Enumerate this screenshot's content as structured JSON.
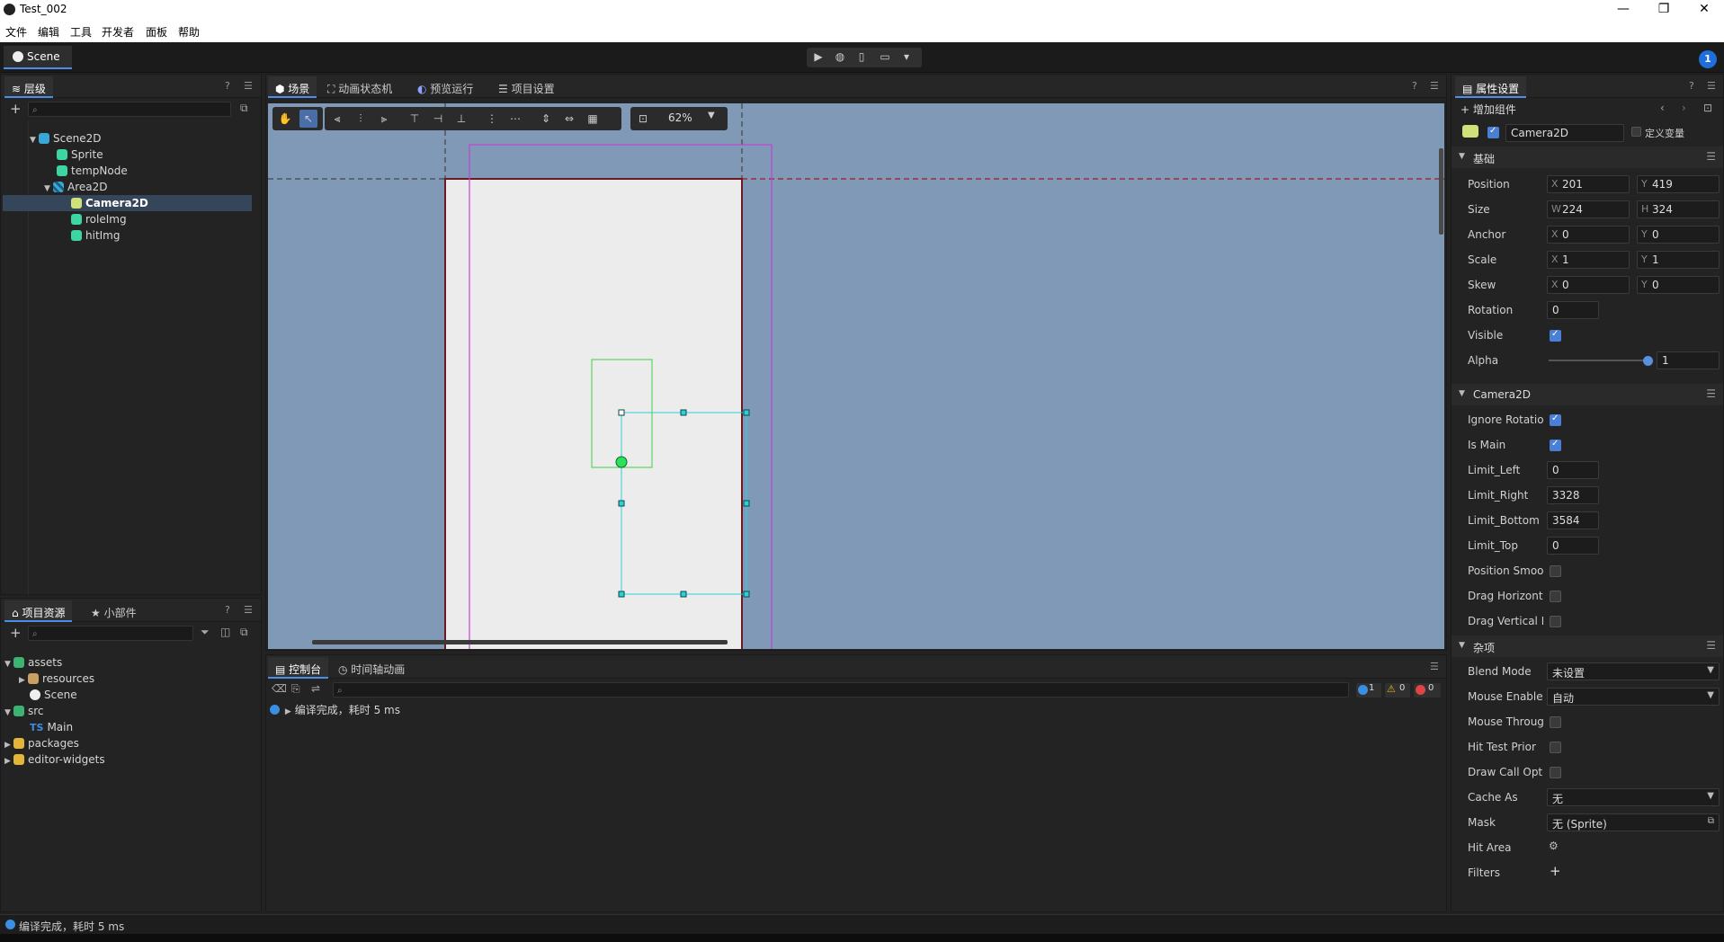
{
  "window": {
    "title": "Test_002",
    "minimize": "—",
    "restore": "❐",
    "close": "✕"
  },
  "menu": [
    "文件",
    "编辑",
    "工具",
    "开发者",
    "面板",
    "帮助"
  ],
  "top": {
    "scene_tab": "Scene",
    "notification_count": "1"
  },
  "hierarchy": {
    "tab": "层级",
    "items": [
      {
        "label": "Scene2D"
      },
      {
        "label": "Sprite"
      },
      {
        "label": "tempNode"
      },
      {
        "label": "Area2D"
      },
      {
        "label": "Camera2D"
      },
      {
        "label": "roleImg"
      },
      {
        "label": "hitImg"
      }
    ]
  },
  "assets": {
    "tabs": [
      "项目资源",
      "小部件"
    ],
    "items": [
      {
        "label": "assets"
      },
      {
        "label": "resources"
      },
      {
        "label": "Scene"
      },
      {
        "label": "src"
      },
      {
        "label": "Main",
        "prefix": "TS"
      },
      {
        "label": "packages"
      },
      {
        "label": "editor-widgets"
      }
    ]
  },
  "center": {
    "tabs": [
      "场景",
      "动画状态机",
      "预览运行",
      "项目设置"
    ],
    "zoom": "62%"
  },
  "console": {
    "tabs": [
      "控制台",
      "时间轴动画"
    ],
    "info_count": "1",
    "warn_count": "0",
    "error_count": "0",
    "message": "编译完成，耗时 5 ms"
  },
  "inspector": {
    "tab": "属性设置",
    "add_component": "增加组件",
    "node_name": "Camera2D",
    "define_var": "定义变量",
    "sections": {
      "base": "基础",
      "camera": "Camera2D",
      "misc": "杂项"
    },
    "position": {
      "label": "Position",
      "x": "201",
      "y": "419"
    },
    "size": {
      "label": "Size",
      "w": "224",
      "h": "324"
    },
    "anchor": {
      "label": "Anchor",
      "x": "0",
      "y": "0"
    },
    "scale": {
      "label": "Scale",
      "x": "1",
      "y": "1"
    },
    "skew": {
      "label": "Skew",
      "x": "0",
      "y": "0"
    },
    "rotation": {
      "label": "Rotation",
      "value": "0"
    },
    "visible": {
      "label": "Visible"
    },
    "alpha": {
      "label": "Alpha",
      "value": "1"
    },
    "ignore_rotation": {
      "label": "Ignore Rotation"
    },
    "is_main": {
      "label": "Is Main"
    },
    "limit_left": {
      "label": "Limit_Left",
      "value": "0"
    },
    "limit_right": {
      "label": "Limit_Right",
      "value": "3328"
    },
    "limit_bottom": {
      "label": "Limit_Bottom",
      "value": "3584"
    },
    "limit_top": {
      "label": "Limit_Top",
      "value": "0"
    },
    "position_smooth": {
      "label": "Position Smoot"
    },
    "drag_h": {
      "label": "Drag Horizonta"
    },
    "drag_v": {
      "label": "Drag Vertical E"
    },
    "blend_mode": {
      "label": "Blend Mode",
      "value": "未设置"
    },
    "mouse_enabled": {
      "label": "Mouse Enablec",
      "value": "自动"
    },
    "mouse_through": {
      "label": "Mouse Througl"
    },
    "hit_test": {
      "label": "Hit Test Prior"
    },
    "draw_call": {
      "label": "Draw Call Optir"
    },
    "cache_as": {
      "label": "Cache As",
      "value": "无"
    },
    "mask": {
      "label": "Mask",
      "value": "无 (Sprite)"
    },
    "hit_area": {
      "label": "Hit Area"
    },
    "filters": {
      "label": "Filters",
      "add": "+"
    }
  },
  "status": {
    "message": "编译完成，耗时 5 ms"
  }
}
